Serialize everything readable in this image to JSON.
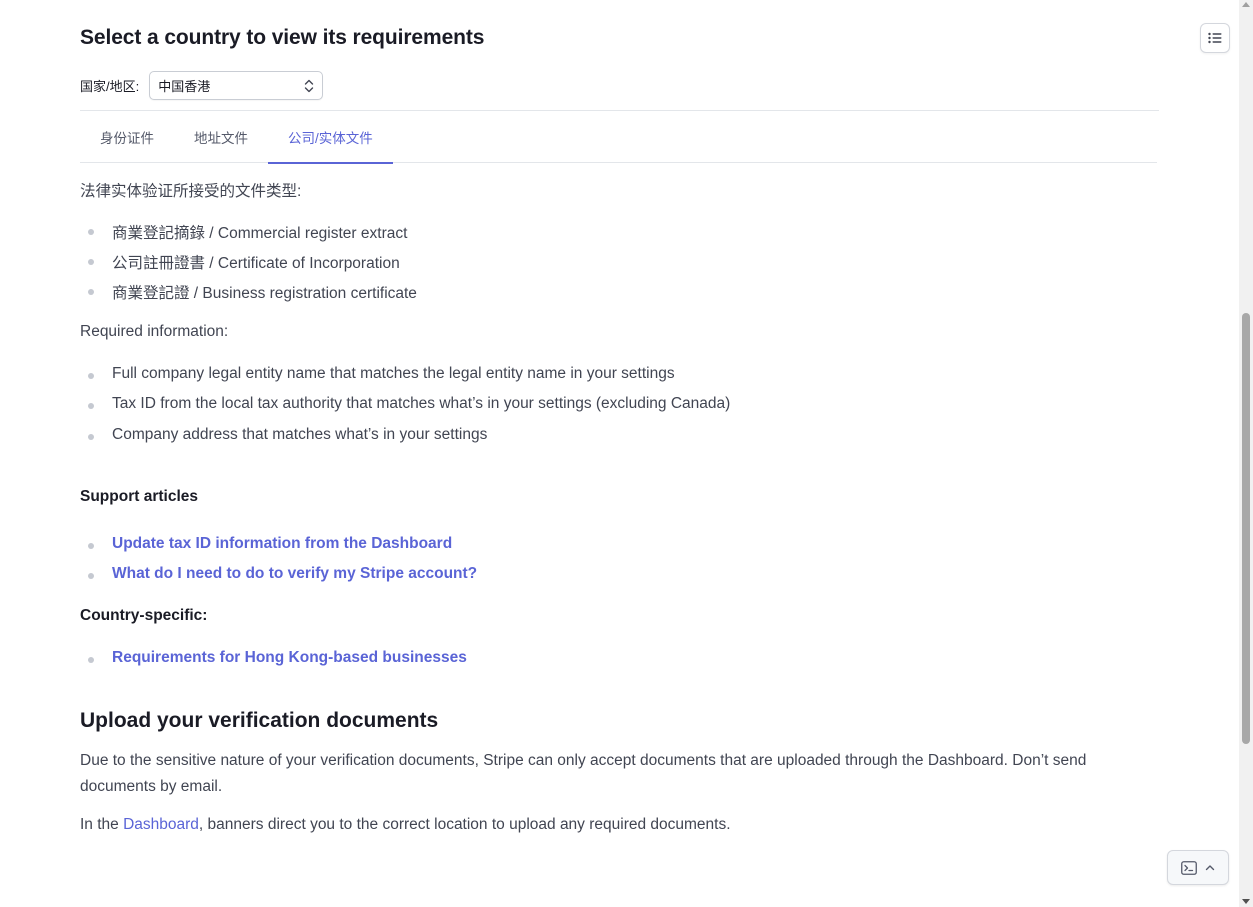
{
  "header": {
    "title": "Select a country to view its requirements"
  },
  "country_selector": {
    "label": "国家/地区:",
    "selected": "中国香港"
  },
  "tabs": [
    {
      "label": "身份证件",
      "active": false
    },
    {
      "label": "地址文件",
      "active": false
    },
    {
      "label": "公司/实体文件",
      "active": true
    }
  ],
  "tab_content": {
    "intro": "法律实体验证所接受的文件类型:",
    "doc_types": [
      "商業登記摘錄 / Commercial register extract",
      "公司註冊證書 / Certificate of Incorporation",
      "商業登記證 / Business registration certificate"
    ],
    "required_label": "Required information:",
    "required_items": [
      "Full company legal entity name that matches the legal entity name in your settings",
      "Tax ID from the local tax authority that matches what’s in your settings (excluding Canada)",
      "Company address that matches what’s in your settings"
    ],
    "support_heading": "Support articles",
    "support_links": [
      "Update tax ID information from the Dashboard",
      "What do I need to do to verify my Stripe account?"
    ],
    "country_specific_heading": "Country-specific:",
    "country_links": [
      "Requirements for Hong Kong-based businesses"
    ]
  },
  "upload_section": {
    "title": "Upload your verification documents",
    "paragraph": "Due to the sensitive nature of your verification documents, Stripe can only accept documents that are uploaded through the Dashboard. Don’t send documents by email.",
    "note_prefix": "In the ",
    "note_link": "Dashboard",
    "note_suffix": ", banners direct you to the correct location to upload any required documents."
  },
  "icons": {
    "toc": "list-icon",
    "console": "terminal-icon",
    "chevron": "chevron-up-icon"
  },
  "colors": {
    "accent": "#5a64d6",
    "heading": "#1a1b25",
    "body": "#414552",
    "bullet": "#c5c9d1"
  }
}
